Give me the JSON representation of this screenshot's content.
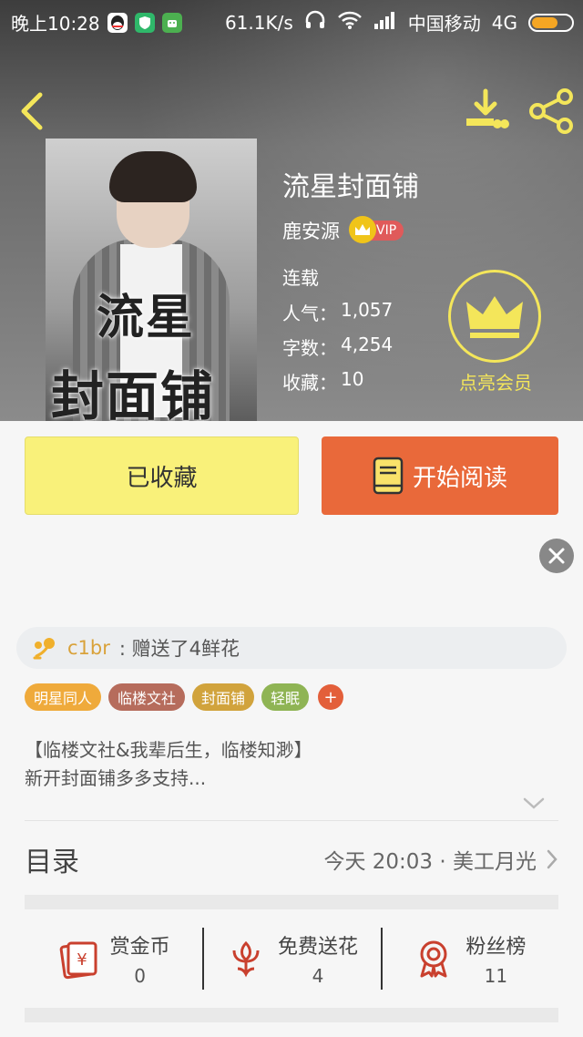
{
  "status_bar": {
    "time": "晚上10:28",
    "speed": "61.1K/s",
    "carrier": "中国移动",
    "network": "4G",
    "icons": [
      "qq-icon",
      "shield-app-icon",
      "android-app-icon",
      "headphones-icon",
      "wifi-icon",
      "signal-icon",
      "battery-icon"
    ]
  },
  "header": {
    "back_icon": "chevron-left-icon",
    "download_icon": "download-icon",
    "share_icon": "share-icon"
  },
  "book": {
    "title": "流星封面铺",
    "author": "鹿安源",
    "vip": "VIP",
    "status": "连载",
    "popularity_label": "人气：",
    "popularity": "1,057",
    "words_label": "字数：",
    "words": "4,254",
    "favorites_label": "收藏：",
    "favorites": "10",
    "cover_text_line1": "流星",
    "cover_text_line2": "封面铺"
  },
  "member": {
    "label": "点亮会员"
  },
  "actions": {
    "favorited_label": "已收藏",
    "read_label": "开始阅读"
  },
  "gift": {
    "user": "c1br",
    "text": ": 赠送了4鲜花"
  },
  "tags": [
    {
      "label": "明星同人",
      "color": "#efaa3b"
    },
    {
      "label": "临楼文社",
      "color": "#b66c5c"
    },
    {
      "label": "封面铺",
      "color": "#d1a33c"
    },
    {
      "label": "轻眠",
      "color": "#8fb454"
    }
  ],
  "tag_add": "+",
  "description": {
    "line1": "【临楼文社&我辈后生，临楼知渺】",
    "line2": "新开封面铺多多支持..."
  },
  "catalog": {
    "title": "目录",
    "latest": "今天 20:03 · 美工月光"
  },
  "bottom_stats": [
    {
      "label": "赏金币",
      "value": "0",
      "icon": "reward-coin-icon"
    },
    {
      "label": "免费送花",
      "value": "4",
      "icon": "flower-icon"
    },
    {
      "label": "粉丝榜",
      "value": "11",
      "icon": "medal-icon"
    }
  ],
  "colors": {
    "accent_orange": "#e9693a",
    "accent_yellow": "#f9f17a",
    "member_yellow": "#f4e65a",
    "icon_red": "#c9402e"
  }
}
